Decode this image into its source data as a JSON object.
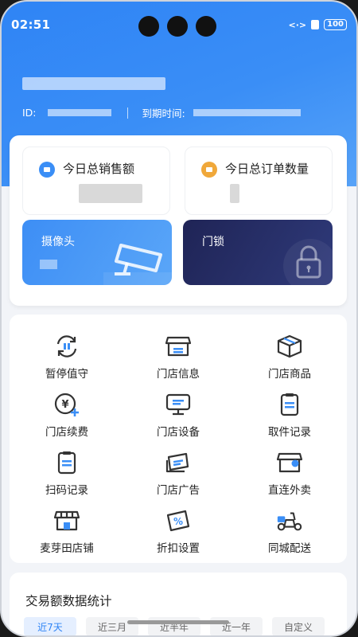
{
  "status": {
    "time": "02:51",
    "battery": "100"
  },
  "header": {
    "id_label": "ID:",
    "expire_label": "到期时间:"
  },
  "stats": [
    {
      "label": "今日总销售额",
      "color": "#3a8ef6"
    },
    {
      "label": "今日总订单数量",
      "color": "#f0a83a"
    }
  ],
  "tiles": [
    {
      "label": "摄像头"
    },
    {
      "label": "门锁"
    }
  ],
  "grid": [
    {
      "label": "暂停值守",
      "icon": "pause-sync-icon"
    },
    {
      "label": "门店信息",
      "icon": "store-info-icon"
    },
    {
      "label": "门店商品",
      "icon": "box-icon"
    },
    {
      "label": "门店续费",
      "icon": "yen-plus-icon"
    },
    {
      "label": "门店设备",
      "icon": "monitor-icon"
    },
    {
      "label": "取件记录",
      "icon": "clipboard-icon"
    },
    {
      "label": "扫码记录",
      "icon": "clipboard-icon"
    },
    {
      "label": "门店广告",
      "icon": "ad-cards-icon"
    },
    {
      "label": "直连外卖",
      "icon": "store-delivery-icon"
    },
    {
      "label": "麦芽田店铺",
      "icon": "store-icon"
    },
    {
      "label": "折扣设置",
      "icon": "discount-icon"
    },
    {
      "label": "同城配送",
      "icon": "scooter-icon"
    }
  ],
  "stats_card": {
    "title": "交易额数据统计",
    "tabs": [
      "近7天",
      "近三月",
      "近半年",
      "近一年",
      "自定义"
    ]
  },
  "colors": {
    "primary": "#2f84f5",
    "icon_stroke": "#333333",
    "icon_accent": "#3a8ef6"
  }
}
